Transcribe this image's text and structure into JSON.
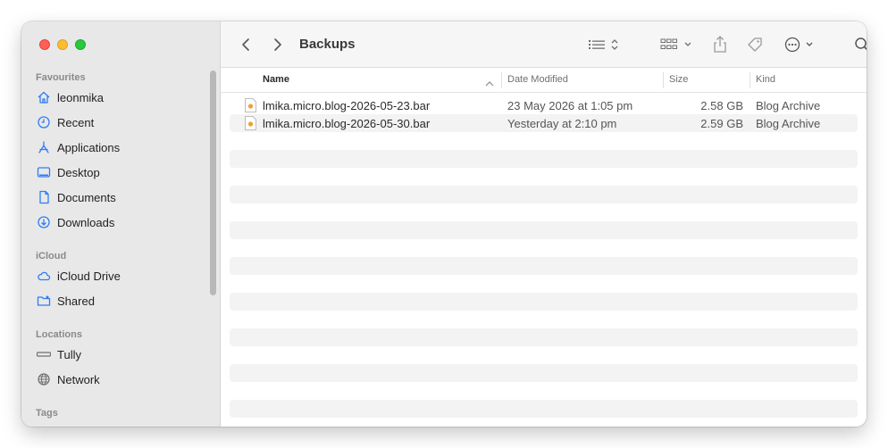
{
  "window": {
    "title": "Backups"
  },
  "sidebar": {
    "sections": [
      {
        "label": "Favourites"
      },
      {
        "label": "iCloud"
      },
      {
        "label": "Locations"
      },
      {
        "label": "Tags"
      }
    ],
    "favourites": [
      {
        "label": "leonmika",
        "icon": "home-icon"
      },
      {
        "label": "Recent",
        "icon": "clock-icon"
      },
      {
        "label": "Applications",
        "icon": "applications-icon"
      },
      {
        "label": "Desktop",
        "icon": "desktop-icon"
      },
      {
        "label": "Documents",
        "icon": "document-icon"
      },
      {
        "label": "Downloads",
        "icon": "download-icon"
      }
    ],
    "icloud": [
      {
        "label": "iCloud Drive",
        "icon": "cloud-icon"
      },
      {
        "label": "Shared",
        "icon": "shared-folder-icon"
      }
    ],
    "locations": [
      {
        "label": "Tully",
        "icon": "drive-icon"
      },
      {
        "label": "Network",
        "icon": "globe-icon"
      }
    ]
  },
  "columns": {
    "name": "Name",
    "date": "Date Modified",
    "size": "Size",
    "kind": "Kind"
  },
  "files": [
    {
      "name": "lmika.micro.blog-2026-05-23.bar",
      "date": "23 May 2026 at 1:05 pm",
      "size": "2.58 GB",
      "kind": "Blog Archive"
    },
    {
      "name": "lmika.micro.blog-2026-05-30.bar",
      "date": "Yesterday at 2:10 pm",
      "size": "2.59 GB",
      "kind": "Blog Archive"
    }
  ],
  "colors": {
    "accent": "#2f7cf6",
    "sidebar_bg": "#e8e8e8",
    "stripe": "#f3f3f3"
  }
}
